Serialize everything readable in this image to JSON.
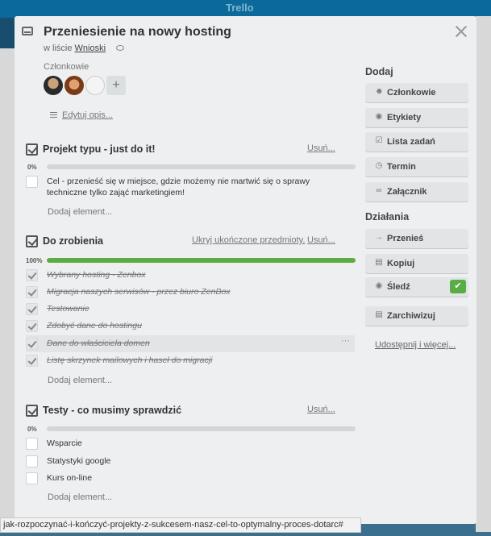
{
  "header": {
    "logo": "Trello"
  },
  "card": {
    "title": "Przeniesienie na nowy hosting",
    "in_list_prefix": "w liście",
    "list_name": "Wnioski",
    "members_label": "Członkowie",
    "edit_description": "Edytuj opis..."
  },
  "checklists": [
    {
      "title": "Projekt typu - just do it!",
      "delete_label": "Usuń...",
      "percent_label": "0%",
      "progress": 0,
      "items": [
        {
          "text": "Cel - przenieść się w miejsce, gdzie możemy nie martwić się o sprawy",
          "done": false
        },
        {
          "text": "techniczne tylko zająć marketingiem!",
          "done": false
        }
      ],
      "add_label": "Dodaj element..."
    },
    {
      "title": "Do zrobienia",
      "hide_label": "Ukryj ukończone przedmioty.",
      "delete_label": "Usuń...",
      "percent_label": "100%",
      "progress": 1,
      "items": [
        {
          "text": "Wybrany hosting - Zenbox",
          "done": true
        },
        {
          "text": "Migracja naszych serwisów - przez biuro ZenBox",
          "done": true
        },
        {
          "text": "Testowanie",
          "done": true
        },
        {
          "text": "Zdobyć dane do hostingu",
          "done": true
        },
        {
          "text": "Dane do właściciela domen",
          "done": true
        },
        {
          "text": "Listę skrzynek mailowych i haseł do migracji",
          "done": true
        }
      ],
      "add_label": "Dodaj element..."
    },
    {
      "title": "Testy - co musimy sprawdzić",
      "delete_label": "Usuń...",
      "percent_label": "0%",
      "progress": 0,
      "items": [
        {
          "text": "Wsparcie",
          "done": false
        },
        {
          "text": "Statystyki google",
          "done": false
        },
        {
          "text": "Kurs on-line",
          "done": false
        }
      ],
      "add_label": "Dodaj element..."
    }
  ],
  "sidebar": {
    "add_heading": "Dodaj",
    "add_buttons": [
      {
        "label": "Członkowie",
        "icon": "person-icon"
      },
      {
        "label": "Etykiety",
        "icon": "tag-icon"
      },
      {
        "label": "Lista zadań",
        "icon": "checklist-icon"
      },
      {
        "label": "Termin",
        "icon": "clock-icon"
      },
      {
        "label": "Załącznik",
        "icon": "paperclip-icon"
      }
    ],
    "actions_heading": "Działania",
    "action_buttons": [
      {
        "label": "Przenieś",
        "icon": "arrow-right-icon"
      },
      {
        "label": "Kopiuj",
        "icon": "card-icon"
      },
      {
        "label": "Śledź",
        "icon": "eye-icon",
        "checked": true
      },
      {
        "label": "Zarchiwizuj",
        "icon": "archive-icon"
      }
    ],
    "share_label": "Udostępnij i więcej..."
  },
  "status_bar": "jak-rozpoczynać-i-kończyć-projekty-z-sukcesem-nasz-cel-to-optymalny-proces-dotarc#",
  "colors": {
    "accent_green": "#5aac44",
    "board_blue": "#0c6a9a"
  }
}
